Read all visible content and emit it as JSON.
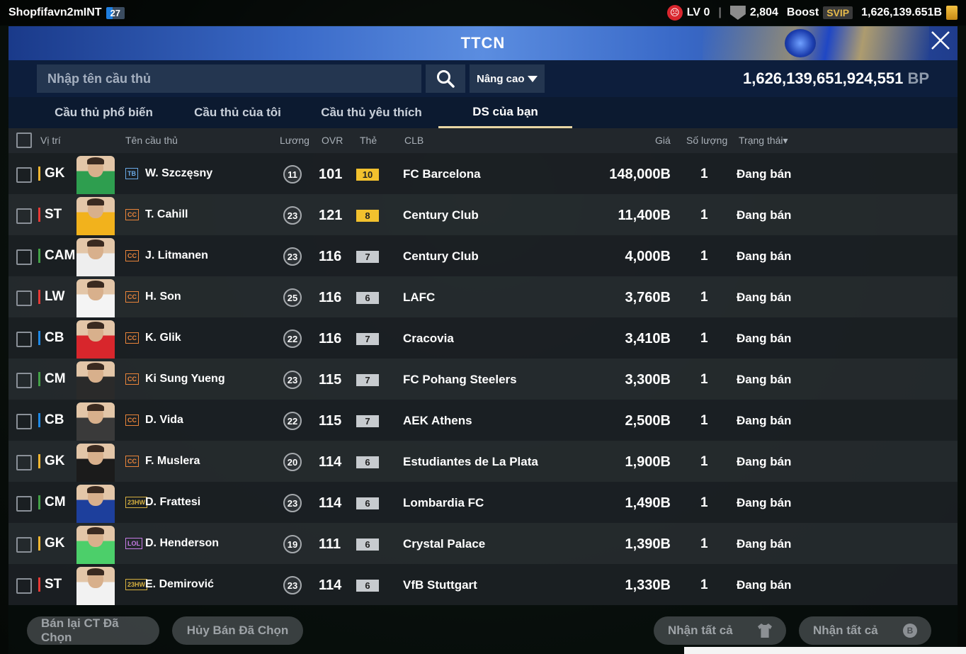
{
  "topbar": {
    "username": "Shopfifavn2mINT",
    "user_level": "27",
    "lv_label": "LV 0",
    "shield_count": "2,804",
    "boost_label": "Boost",
    "svip_label": "SVIP",
    "coins": "1,626,139.651B"
  },
  "modal": {
    "title": "TTCN",
    "close_label": "╳",
    "search": {
      "placeholder": "Nhập tên cầu thủ",
      "value": ""
    },
    "advanced_label": "Nâng cao",
    "balance_value": "1,626,139,651,924,551",
    "balance_unit": "BP"
  },
  "tabs": [
    {
      "label": "Cầu thủ phổ biến",
      "active": false
    },
    {
      "label": "Cầu thủ của tôi",
      "active": false
    },
    {
      "label": "Cầu thủ yêu thích",
      "active": false
    },
    {
      "label": "DS của bạn",
      "active": true
    }
  ],
  "columns": {
    "position": "Vị trí",
    "name": "Tên cầu thủ",
    "wage": "Lương",
    "ovr": "OVR",
    "card": "Thẻ",
    "club": "CLB",
    "price": "Giá",
    "qty": "Số lượng",
    "status": "Trạng thái▾"
  },
  "colors": {
    "gk": "#f2b632",
    "st": "#e53935",
    "mid": "#43a047",
    "def": "#1e88e5",
    "upgrade_gold": "#f2c12e",
    "upgrade_silver": "#c7cbcf"
  },
  "rows": [
    {
      "position": "GK",
      "pos_color": "#f2b632",
      "kit": "#2e9e4f",
      "season": "TB",
      "season_color": "#6aa9e6",
      "name": "W. Szczęsny",
      "wage": "11",
      "ovr": "101",
      "upgrade": "10",
      "upgrade_color": "#f2c12e",
      "club": "FC Barcelona",
      "price": "148,000B",
      "qty": "1",
      "status": "Đang bán"
    },
    {
      "position": "ST",
      "pos_color": "#e53935",
      "kit": "#f2b21c",
      "season": "CC",
      "season_color": "#e9843a",
      "name": "T. Cahill",
      "wage": "23",
      "ovr": "121",
      "upgrade": "8",
      "upgrade_color": "#f2c12e",
      "club": "Century Club",
      "price": "11,400B",
      "qty": "1",
      "status": "Đang bán"
    },
    {
      "position": "CAM",
      "pos_color": "#43a047",
      "kit": "#eeeeee",
      "season": "CC",
      "season_color": "#e9843a",
      "name": "J. Litmanen",
      "wage": "23",
      "ovr": "116",
      "upgrade": "7",
      "upgrade_color": "#c7cbcf",
      "club": "Century Club",
      "price": "4,000B",
      "qty": "1",
      "status": "Đang bán"
    },
    {
      "position": "LW",
      "pos_color": "#e53935",
      "kit": "#f4f4f4",
      "season": "CC",
      "season_color": "#e9843a",
      "name": "H. Son",
      "wage": "25",
      "ovr": "116",
      "upgrade": "6",
      "upgrade_color": "#c7cbcf",
      "club": "LAFC",
      "price": "3,760B",
      "qty": "1",
      "status": "Đang bán"
    },
    {
      "position": "CB",
      "pos_color": "#1e88e5",
      "kit": "#d8262c",
      "season": "CC",
      "season_color": "#e9843a",
      "name": "K. Glik",
      "wage": "22",
      "ovr": "116",
      "upgrade": "7",
      "upgrade_color": "#c7cbcf",
      "club": "Cracovia",
      "price": "3,410B",
      "qty": "1",
      "status": "Đang bán"
    },
    {
      "position": "CM",
      "pos_color": "#43a047",
      "kit": "#2a2a2a",
      "season": "CC",
      "season_color": "#e9843a",
      "name": "Ki Sung Yueng",
      "wage": "23",
      "ovr": "115",
      "upgrade": "7",
      "upgrade_color": "#c7cbcf",
      "club": "FC Pohang Steelers",
      "price": "3,300B",
      "qty": "1",
      "status": "Đang bán"
    },
    {
      "position": "CB",
      "pos_color": "#1e88e5",
      "kit": "#3a3a3a",
      "season": "CC",
      "season_color": "#e9843a",
      "name": "D. Vida",
      "wage": "22",
      "ovr": "115",
      "upgrade": "7",
      "upgrade_color": "#c7cbcf",
      "club": "AEK Athens",
      "price": "2,500B",
      "qty": "1",
      "status": "Đang bán"
    },
    {
      "position": "GK",
      "pos_color": "#f2b632",
      "kit": "#1b1b1b",
      "season": "CC",
      "season_color": "#e9843a",
      "name": "F. Muslera",
      "wage": "20",
      "ovr": "114",
      "upgrade": "6",
      "upgrade_color": "#c7cbcf",
      "club": "Estudiantes de La Plata",
      "price": "1,900B",
      "qty": "1",
      "status": "Đang bán"
    },
    {
      "position": "CM",
      "pos_color": "#43a047",
      "kit": "#1d3f9c",
      "season": "23HW",
      "season_color": "#d6b040",
      "name": "D. Frattesi",
      "wage": "23",
      "ovr": "114",
      "upgrade": "6",
      "upgrade_color": "#c7cbcf",
      "club": "Lombardia FC",
      "price": "1,490B",
      "qty": "1",
      "status": "Đang bán"
    },
    {
      "position": "GK",
      "pos_color": "#f2b632",
      "kit": "#4ccf6a",
      "season": "LOL",
      "season_color": "#c77be6",
      "name": "D. Henderson",
      "wage": "19",
      "ovr": "111",
      "upgrade": "6",
      "upgrade_color": "#c7cbcf",
      "club": "Crystal Palace",
      "price": "1,390B",
      "qty": "1",
      "status": "Đang bán"
    },
    {
      "position": "ST",
      "pos_color": "#e53935",
      "kit": "#f2f2f2",
      "season": "23HW",
      "season_color": "#d6b040",
      "name": "E. Demirović",
      "wage": "23",
      "ovr": "114",
      "upgrade": "6",
      "upgrade_color": "#c7cbcf",
      "club": "VfB Stuttgart",
      "price": "1,330B",
      "qty": "1",
      "status": "Đang bán"
    }
  ],
  "footer": {
    "resell_selected": "Bán lại CT Đã Chọn",
    "cancel_selected": "Hủy Bán Đã Chọn",
    "claim_all_1": "Nhận tất cả",
    "claim_all_2": "Nhận tất cả"
  }
}
